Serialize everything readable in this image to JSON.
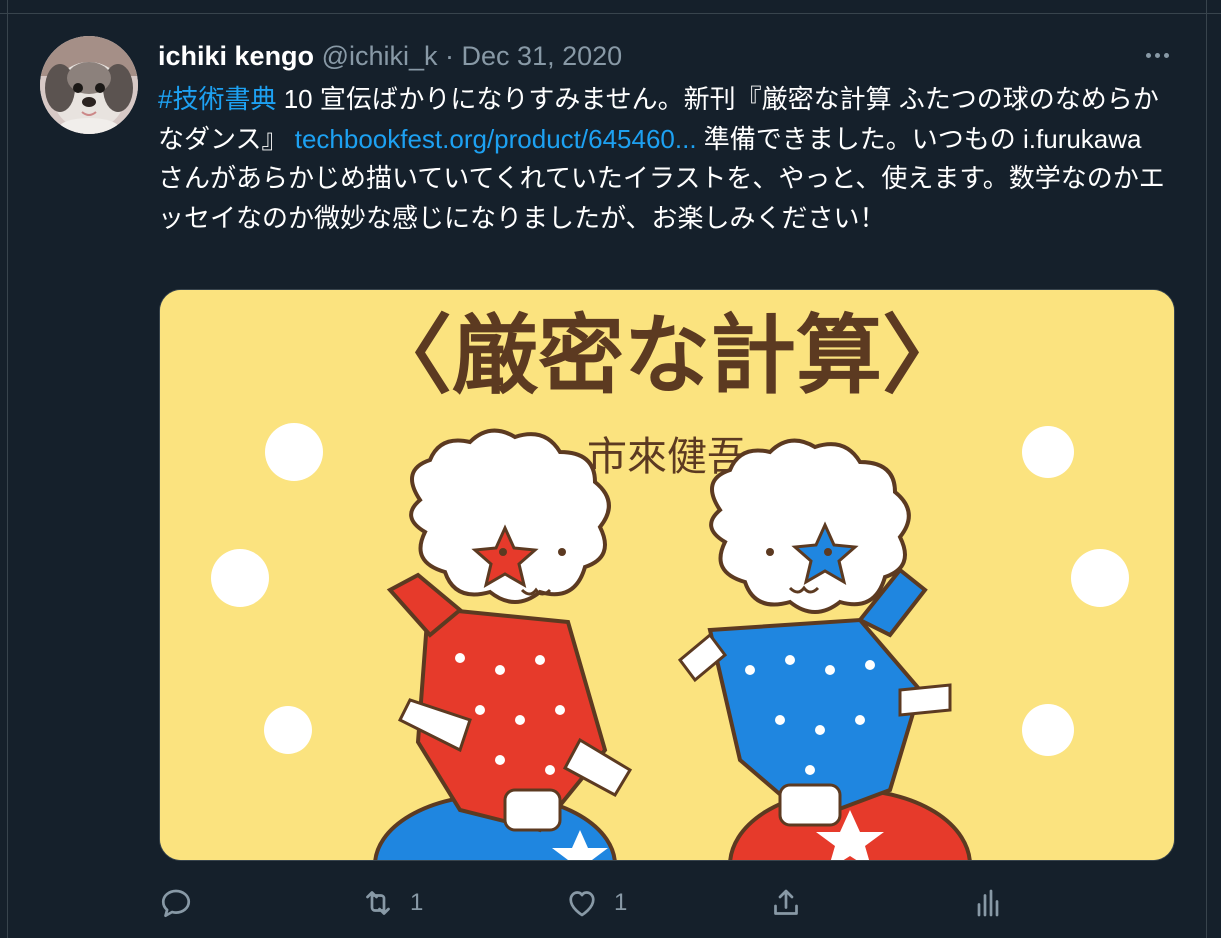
{
  "tweet": {
    "author_name": "ichiki kengo",
    "author_handle": "@ichiki_k",
    "separator": "·",
    "date": "Dec 31, 2020",
    "hashtag": "#技術書典",
    "text_part1": " 10 宣伝ばかりになりすみません。新刊『厳密な計算 ふたつの球のなめらかなダンス』 ",
    "link": "techbookfest.org/product/645460...",
    "text_part2": " 準備できました。いつもの i.furukawa さんがあらかじめ描いていてくれていたイラストを、やっと、使えます。数学なのかエッセイなのか微妙な感じになりましたが、お楽しみください！"
  },
  "media": {
    "title": "〈厳密な計算〉",
    "author": "市來健吾",
    "background_color": "#fbe37f",
    "title_color": "#5c3a21"
  },
  "actions": {
    "reply_icon": "reply-icon",
    "retweet_icon": "retweet-icon",
    "retweet_count": "1",
    "like_icon": "heart-icon",
    "like_count": "1",
    "share_icon": "share-icon",
    "analytics_icon": "analytics-icon"
  },
  "colors": {
    "background": "#15202b",
    "link": "#1da1f2",
    "muted": "#8899a6",
    "border": "#38444d"
  }
}
